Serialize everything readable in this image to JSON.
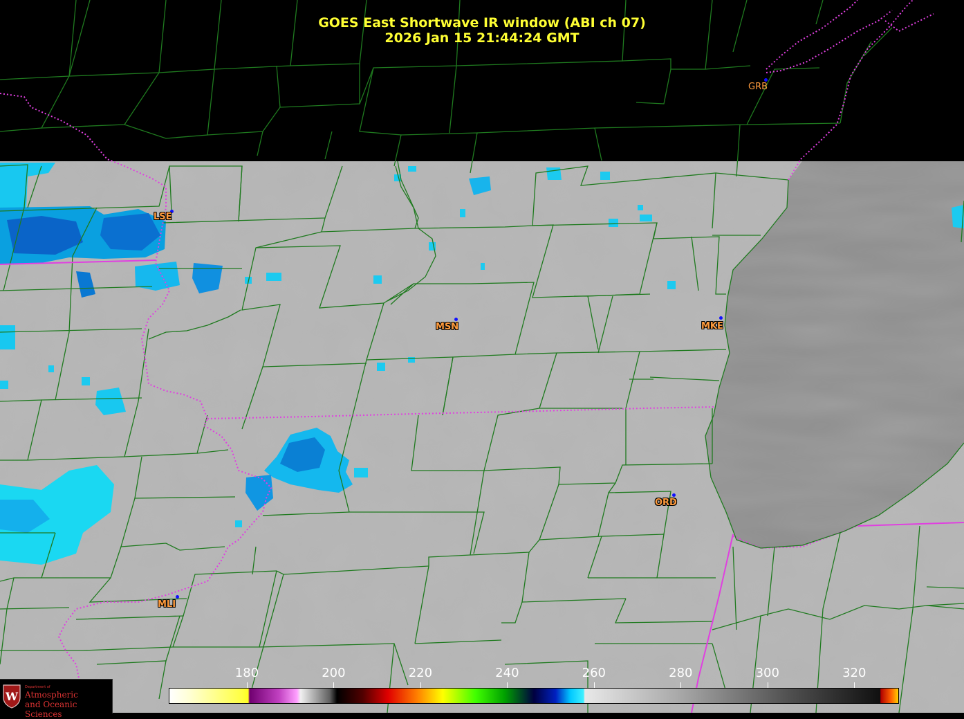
{
  "header": {
    "title": "GOES East Shortwave IR window (ABI ch 07)",
    "timestamp": "2026 Jan 15  21:44:24 GMT"
  },
  "cities": [
    {
      "label": "GRB",
      "color": "#ff9b3d"
    },
    {
      "label": "LSE",
      "color": "#ff9b3d"
    },
    {
      "label": "MSN",
      "color": "#ff9b3d"
    },
    {
      "label": "MKE",
      "color": "#ff9b3d"
    },
    {
      "label": "ORD",
      "color": "#ff9b3d"
    },
    {
      "label": "MLI",
      "color": "#ff9b3d"
    }
  ],
  "colorbar": {
    "unit_range": [
      162,
      330
    ],
    "ticks": [
      "180",
      "200",
      "220",
      "240",
      "260",
      "280",
      "300",
      "320"
    ],
    "tick_values": [
      180,
      200,
      220,
      240,
      260,
      280,
      300,
      320
    ]
  },
  "logo": {
    "department": "Department of",
    "name_line1": "Atmospheric",
    "name_line2": "and Oceanic Sciences",
    "crest_letter": "W"
  },
  "colors": {
    "title": "#ffff33",
    "county_lines": "#1f7a1f",
    "state_borders": "#e040e0",
    "cold_cloud": "#00d8ff",
    "background": "#000000"
  }
}
